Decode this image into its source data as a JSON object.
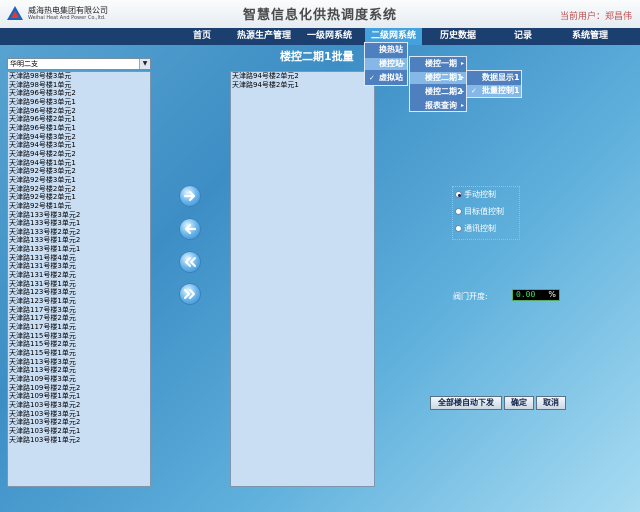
{
  "header": {
    "company_cn": "威海热电集团有限公司",
    "company_en": "Weihai Heat And Power Co.,ltd.",
    "system_title": "智慧信息化供热调度系统",
    "user_label": "当前用户：郑昌伟"
  },
  "nav": {
    "items": [
      {
        "label": "首页"
      },
      {
        "label": "热源生产管理"
      },
      {
        "label": "一级网系统"
      },
      {
        "label": "二级网系统"
      },
      {
        "label": "历史数据"
      },
      {
        "label": "记录"
      },
      {
        "label": "系统管理"
      }
    ]
  },
  "menus": {
    "level1": [
      {
        "label": "换热站"
      },
      {
        "label": "楼控站"
      },
      {
        "label": "虚拟站"
      }
    ],
    "level2": [
      {
        "label": "楼控一期"
      },
      {
        "label": "楼控二期1"
      },
      {
        "label": "楼控二期2"
      },
      {
        "label": "报表查询"
      }
    ],
    "level3": [
      {
        "label": "数据显示1"
      },
      {
        "label": "批量控制1"
      }
    ],
    "check_mark": "✓",
    "submenu_arrow": "▸"
  },
  "page": {
    "title": "楼控二期1批量"
  },
  "left_panel": {
    "dropdown_value": "华明二支",
    "items": [
      "天津路98号楼3单元",
      "天津路98号楼1单元",
      "天津路96号楼3单元2",
      "天津路96号楼3单元1",
      "天津路96号楼2单元2",
      "天津路96号楼2单元1",
      "天津路96号楼1单元1",
      "天津路94号楼3单元2",
      "天津路94号楼3单元1",
      "天津路94号楼2单元2",
      "天津路94号楼1单元1",
      "天津路92号楼3单元2",
      "天津路92号楼3单元1",
      "天津路92号楼2单元2",
      "天津路92号楼2单元1",
      "天津路92号楼1单元",
      "天津路133号楼3单元2",
      "天津路133号楼3单元1",
      "天津路133号楼2单元2",
      "天津路133号楼1单元2",
      "天津路133号楼1单元1",
      "天津路131号楼4单元",
      "天津路131号楼3单元",
      "天津路131号楼2单元",
      "天津路131号楼1单元",
      "天津路123号楼3单元",
      "天津路123号楼1单元",
      "天津路117号楼3单元",
      "天津路117号楼2单元",
      "天津路117号楼1单元",
      "天津路115号楼3单元",
      "天津路115号楼2单元",
      "天津路115号楼1单元",
      "天津路113号楼3单元",
      "天津路113号楼2单元",
      "天津路109号楼3单元",
      "天津路109号楼2单元2",
      "天津路109号楼1单元1",
      "天津路103号楼3单元2",
      "天津路103号楼3单元1",
      "天津路103号楼2单元2",
      "天津路103号楼2单元1",
      "天津路103号楼1单元2"
    ]
  },
  "right_panel": {
    "items": [
      "天津路94号楼2单元2",
      "天津路94号楼2单元1"
    ]
  },
  "controls": {
    "radios": [
      {
        "label": "手动控制",
        "selected": true
      },
      {
        "label": "目标值控制",
        "selected": false
      },
      {
        "label": "通讯控制",
        "selected": false
      }
    ],
    "valve_label": "阀门开度:",
    "valve_value": "0.00",
    "valve_unit": "%",
    "buttons": {
      "auto_issue": "全部楼自动下发",
      "confirm": "确定",
      "cancel": "取消"
    }
  },
  "icons": {
    "logo": "company-logo",
    "move_right": "arrow-right-icon",
    "move_left": "arrow-left-icon",
    "move_all_left": "double-arrow-left-icon",
    "move_all_right": "double-arrow-right-icon"
  },
  "colors": {
    "nav_bg": "#1b3f6f",
    "nav_active": "#43a1de",
    "menu_bg": "#4e7fbf",
    "list_bg": "#c9ddf3",
    "user_text": "#c05050",
    "valve_digits": "#3fe05c"
  }
}
